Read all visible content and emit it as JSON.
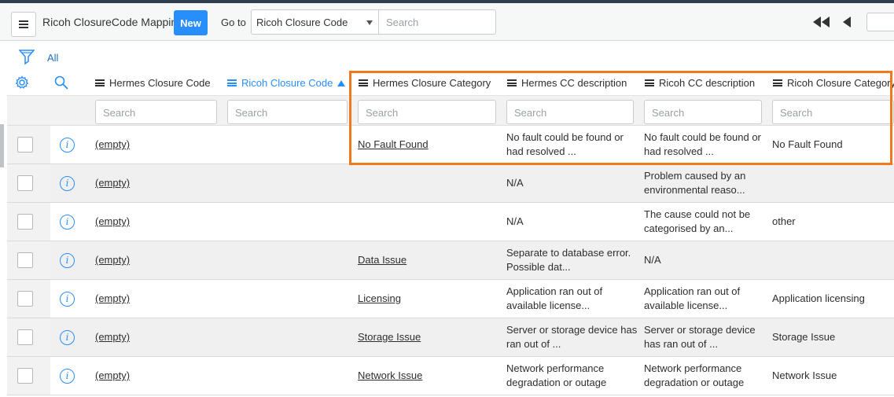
{
  "header": {
    "title": "Ricoh ClosureCode Mappings",
    "new_label": "New",
    "goto_label": "Go to",
    "goto_value": "Ricoh Closure Code",
    "search_placeholder": "Search"
  },
  "filter": {
    "all_label": "All"
  },
  "columns": [
    {
      "key": "hermes_code",
      "label": "Hermes Closure Code",
      "sorted": false
    },
    {
      "key": "ricoh_code",
      "label": "Ricoh Closure Code",
      "sorted": true,
      "sort_dir": "asc"
    },
    {
      "key": "hermes_category",
      "label": "Hermes Closure Category",
      "sorted": false
    },
    {
      "key": "hermes_desc",
      "label": "Hermes CC description",
      "sorted": false
    },
    {
      "key": "ricoh_desc",
      "label": "Ricoh CC description",
      "sorted": false
    },
    {
      "key": "ricoh_category",
      "label": "Ricoh Closure Category",
      "sorted": false
    }
  ],
  "column_search_placeholder": "Search",
  "rows": [
    {
      "hermes_code": "(empty)",
      "ricoh_code": "",
      "hermes_category": "No Fault Found",
      "hermes_desc": [
        "No fault could be found or",
        "had resolved ..."
      ],
      "ricoh_desc": [
        "No fault could be found or",
        "had resolved ..."
      ],
      "ricoh_category": "No Fault Found"
    },
    {
      "hermes_code": "(empty)",
      "ricoh_code": "",
      "hermes_category": "",
      "hermes_desc": [
        "N/A"
      ],
      "ricoh_desc": [
        "Problem caused by an",
        "environmental reaso..."
      ],
      "ricoh_category": ""
    },
    {
      "hermes_code": "(empty)",
      "ricoh_code": "",
      "hermes_category": "",
      "hermes_desc": [
        "N/A"
      ],
      "ricoh_desc": [
        "The cause could not be",
        "categorised by an..."
      ],
      "ricoh_category": "other"
    },
    {
      "hermes_code": "(empty)",
      "ricoh_code": "",
      "hermes_category": "Data Issue",
      "hermes_desc": [
        "Separate to database error.",
        "Possible dat..."
      ],
      "ricoh_desc": [
        "N/A"
      ],
      "ricoh_category": ""
    },
    {
      "hermes_code": "(empty)",
      "ricoh_code": "",
      "hermes_category": "Licensing",
      "hermes_desc": [
        "Application ran out of",
        "available license..."
      ],
      "ricoh_desc": [
        "Application ran out of",
        "available license..."
      ],
      "ricoh_category": "Application licensing"
    },
    {
      "hermes_code": "(empty)",
      "ricoh_code": "",
      "hermes_category": "Storage Issue",
      "hermes_desc": [
        "Server or storage device has",
        "ran out of ..."
      ],
      "ricoh_desc": [
        "Server or storage device",
        "has ran out of ..."
      ],
      "ricoh_category": "Storage Issue"
    },
    {
      "hermes_code": "(empty)",
      "ricoh_code": "",
      "hermes_category": "Network Issue",
      "hermes_desc": [
        "Network performance",
        "degradation or outage"
      ],
      "ricoh_desc": [
        "Network performance",
        "degradation or outage"
      ],
      "ricoh_category": "Network Issue"
    }
  ],
  "colors": {
    "accent": "#278efc",
    "highlight": "#f07a1b",
    "header_bg": "#f6f7f7"
  }
}
